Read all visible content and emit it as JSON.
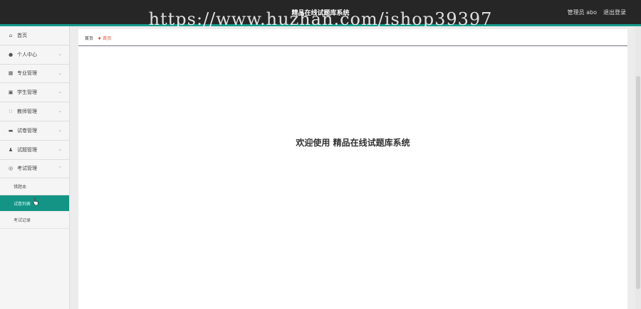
{
  "header": {
    "title": "精品在线试题库系统",
    "watermark": "https://www.huzhan.com/ishop39397",
    "admin_label": "管理员 abo",
    "logout_label": "退出登录"
  },
  "sidebar": {
    "items": [
      {
        "label": "首页",
        "icon": "home-icon"
      },
      {
        "label": "个人中心",
        "icon": "user-icon"
      },
      {
        "label": "专业管理",
        "icon": "grid-icon"
      },
      {
        "label": "学生管理",
        "icon": "calendar-icon"
      },
      {
        "label": "教师管理",
        "icon": "apps-icon"
      },
      {
        "label": "试卷管理",
        "icon": "monitor-icon"
      },
      {
        "label": "试题管理",
        "icon": "person-icon"
      },
      {
        "label": "考试管理",
        "icon": "clock-icon"
      }
    ],
    "sub_items": [
      {
        "label": "错题本",
        "active": false
      },
      {
        "label": "试卷列表",
        "active": true
      },
      {
        "label": "考试记录",
        "active": false
      }
    ]
  },
  "breadcrumb": {
    "root": "首页",
    "current": "首页"
  },
  "main": {
    "welcome": "欢迎使用 精品在线试题库系统"
  },
  "colors": {
    "accent": "#139484",
    "header_bg": "#262626",
    "breadcrumb_current": "#e0522d"
  }
}
